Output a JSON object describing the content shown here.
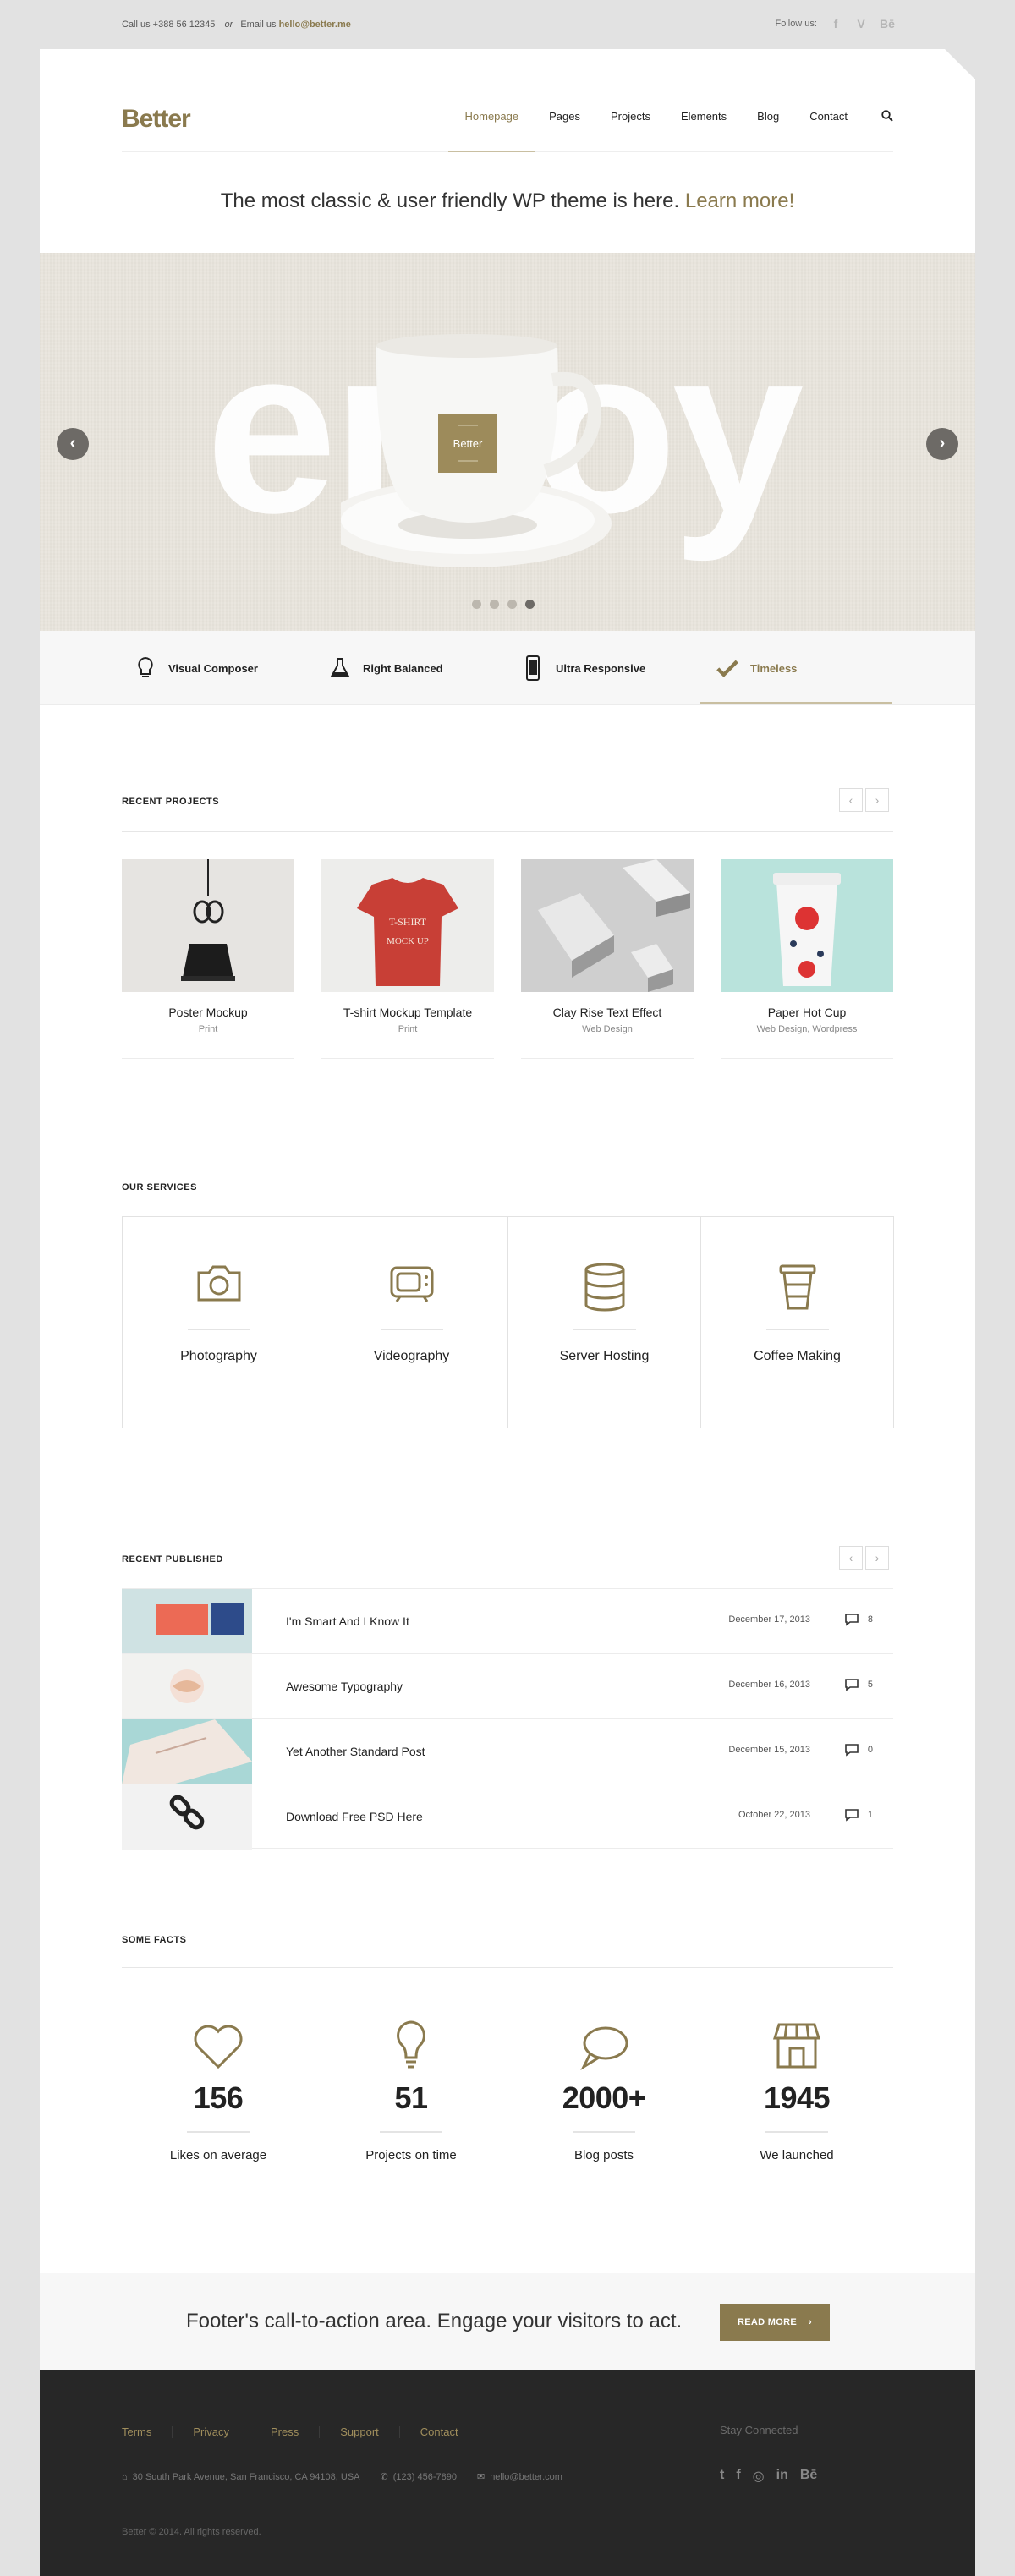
{
  "topbar": {
    "phone": "Call us +388 56 12345",
    "or": "or",
    "email_label": "Email us",
    "email": "hello@better.me",
    "follow_label": "Follow us:",
    "social": [
      {
        "icon": "facebook-icon",
        "glyph": "f"
      },
      {
        "icon": "vimeo-icon",
        "glyph": "V"
      },
      {
        "icon": "behance-icon",
        "glyph": "Bē"
      }
    ]
  },
  "header": {
    "logo": "Better",
    "nav": [
      "Homepage",
      "Pages",
      "Projects",
      "Elements",
      "Blog",
      "Contact"
    ],
    "active_nav": "Homepage"
  },
  "tagline": {
    "text": "The most classic & user friendly WP theme is here.",
    "link": "Learn more!"
  },
  "slider": {
    "word": "enjoy",
    "cup_label": "Better",
    "slides": 4,
    "active_slide": 4
  },
  "features": [
    {
      "label": "Visual Composer",
      "icon": "lightbulb-icon"
    },
    {
      "label": "Right Balanced",
      "icon": "flask-icon"
    },
    {
      "label": "Ultra Responsive",
      "icon": "phone-icon"
    },
    {
      "label": "Timeless",
      "icon": "check-icon"
    }
  ],
  "recent_projects": {
    "title": "RECENT PROJECTS",
    "items": [
      {
        "name": "Poster Mockup",
        "category": "Print"
      },
      {
        "name": "T-shirt Mockup Template",
        "category": "Print"
      },
      {
        "name": "Clay Rise Text Effect",
        "category": "Web Design"
      },
      {
        "name": "Paper Hot Cup",
        "category": "Web Design, Wordpress"
      }
    ]
  },
  "services": {
    "title": "OUR SERVICES",
    "items": [
      {
        "name": "Photography",
        "icon": "camera-icon"
      },
      {
        "name": "Videography",
        "icon": "tv-icon"
      },
      {
        "name": "Server Hosting",
        "icon": "database-icon"
      },
      {
        "name": "Coffee Making",
        "icon": "coffee-cup-icon"
      }
    ]
  },
  "recent_published": {
    "title": "RECENT PUBLISHED",
    "posts": [
      {
        "title": "I'm Smart And I Know It",
        "date": "December 17, 2013",
        "comments": "8"
      },
      {
        "title": "Awesome Typography",
        "date": "December 16, 2013",
        "comments": "5"
      },
      {
        "title": "Yet Another Standard Post",
        "date": "December 15, 2013",
        "comments": "0"
      },
      {
        "title": "Download Free PSD Here",
        "date": "October 22, 2013",
        "comments": "1"
      }
    ]
  },
  "facts": {
    "title": "SOME FACTS",
    "items": [
      {
        "number": "156",
        "label": "Likes on average",
        "icon": "heart-icon"
      },
      {
        "number": "51",
        "label": "Projects on time",
        "icon": "lightbulb-icon"
      },
      {
        "number": "2000+",
        "label": "Blog posts",
        "icon": "speech-bubble-icon"
      },
      {
        "number": "1945",
        "label": "We launched",
        "icon": "store-icon"
      }
    ]
  },
  "cta": {
    "text": "Footer's call-to-action area. Engage your visitors to act.",
    "button": "READ MORE"
  },
  "footer": {
    "nav": [
      "Terms",
      "Privacy",
      "Press",
      "Support",
      "Contact"
    ],
    "address": "30 South Park Avenue, San Francisco, CA 94108, USA",
    "phone": "(123) 456-7890",
    "email": "hello@better.com",
    "copyright": "Better © 2014. All rights reserved.",
    "stay_connected": "Stay Connected",
    "social": [
      {
        "icon": "twitter-icon",
        "glyph": "t"
      },
      {
        "icon": "facebook-icon",
        "glyph": "f"
      },
      {
        "icon": "dribbble-icon",
        "glyph": "◎"
      },
      {
        "icon": "linkedin-icon",
        "glyph": "in"
      },
      {
        "icon": "behance-icon",
        "glyph": "Bē"
      }
    ]
  },
  "colors": {
    "accent": "#8a7a4e",
    "footer_bg": "#272727",
    "page_bg": "#e2e2e2"
  }
}
